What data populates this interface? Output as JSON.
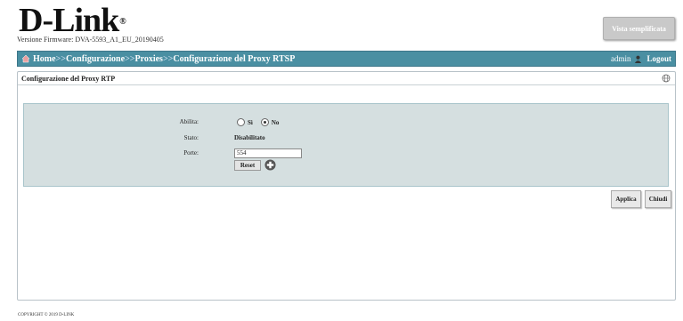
{
  "header": {
    "logo_text": "D-Link",
    "logo_reg": "®",
    "firmware": "Versione Firmware: DVA-5593_A1_EU_20190405",
    "simple_view_label": "Vista semplificata"
  },
  "navbar": {
    "breadcrumb": [
      "Home",
      "Configurazione",
      "Proxies",
      "Configurazione del Proxy RTSP"
    ],
    "separator": ">>",
    "user": "admin",
    "logout_label": "Logout",
    "bar_color": "#4a8fa2"
  },
  "panel": {
    "title": "Configurazione del Proxy RTP",
    "form": {
      "enable_label": "Abilita:",
      "enable_options": [
        "Sì",
        "No"
      ],
      "enable_selected": "No",
      "status_label": "Stato:",
      "status_value": "Disabilitato",
      "ports_label": "Porte:",
      "port_value": "554",
      "reset_label": "Reset"
    },
    "apply_label": "Applica",
    "close_label": "Chiudi"
  },
  "footer": {
    "copyright": "COPYRIGHT © 2019 D-LINK"
  }
}
